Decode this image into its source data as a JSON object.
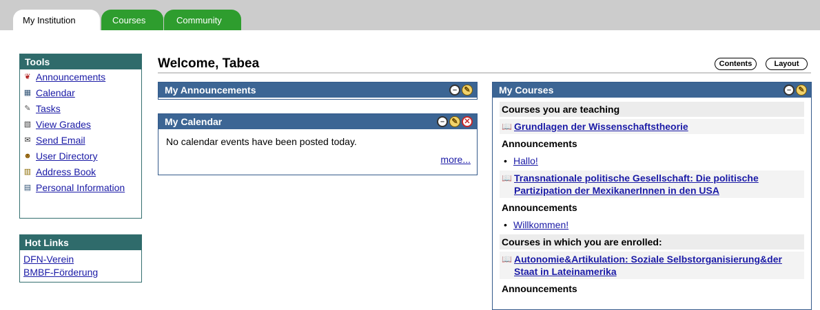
{
  "tabs": [
    {
      "label": "My Institution"
    },
    {
      "label": "Courses"
    },
    {
      "label": "Community"
    }
  ],
  "tools": {
    "title": "Tools",
    "items": [
      {
        "label": "Announcements",
        "icon": "megaphone-icon",
        "glyph": "❦",
        "color": "#b22222"
      },
      {
        "label": "Calendar",
        "icon": "calendar-icon",
        "glyph": "▦",
        "color": "#335577"
      },
      {
        "label": "Tasks",
        "icon": "tasks-icon",
        "glyph": "✎",
        "color": "#555555"
      },
      {
        "label": "View Grades",
        "icon": "grades-icon",
        "glyph": "▧",
        "color": "#444444"
      },
      {
        "label": "Send Email",
        "icon": "envelope-icon",
        "glyph": "✉",
        "color": "#333333"
      },
      {
        "label": "User Directory",
        "icon": "user-directory-icon",
        "glyph": "☻",
        "color": "#8b5a00"
      },
      {
        "label": "Address Book",
        "icon": "address-book-icon",
        "glyph": "▥",
        "color": "#8b6b00"
      },
      {
        "label": "Personal Information",
        "icon": "personal-info-icon",
        "glyph": "▤",
        "color": "#335577"
      }
    ]
  },
  "hotlinks": {
    "title": "Hot Links",
    "items": [
      {
        "label": "DFN-Verein"
      },
      {
        "label": "BMBF-Förderung"
      }
    ]
  },
  "main": {
    "welcome": "Welcome, Tabea",
    "contents_label": "Contents",
    "layout_label": "Layout"
  },
  "announcements_module": {
    "title": "My Announcements"
  },
  "calendar_module": {
    "title": "My Calendar",
    "message": "No calendar events have been posted today.",
    "more": "more..."
  },
  "courses_module": {
    "title": "My Courses",
    "teaching_label": "Courses you are teaching",
    "enrolled_label": "Courses in which you are enrolled:",
    "announcements_label": "Announcements",
    "courses": [
      {
        "name": "Grundlagen der Wissenschaftstheorie",
        "announcement": "Hallo!"
      },
      {
        "name": "Transnationale politische Gesellschaft: Die politische Partizipation der MexikanerInnen in den USA",
        "announcement": "Willkommen!"
      },
      {
        "name": "Autonomie&Artikulation: Soziale Selbstorganisierung&der Staat in Lateinamerika"
      }
    ]
  },
  "colors": {
    "tab_green": "#2e9d2e",
    "sidebar_header": "#2f6b6b",
    "module_header": "#3c6594",
    "link": "#1a1aa6"
  }
}
